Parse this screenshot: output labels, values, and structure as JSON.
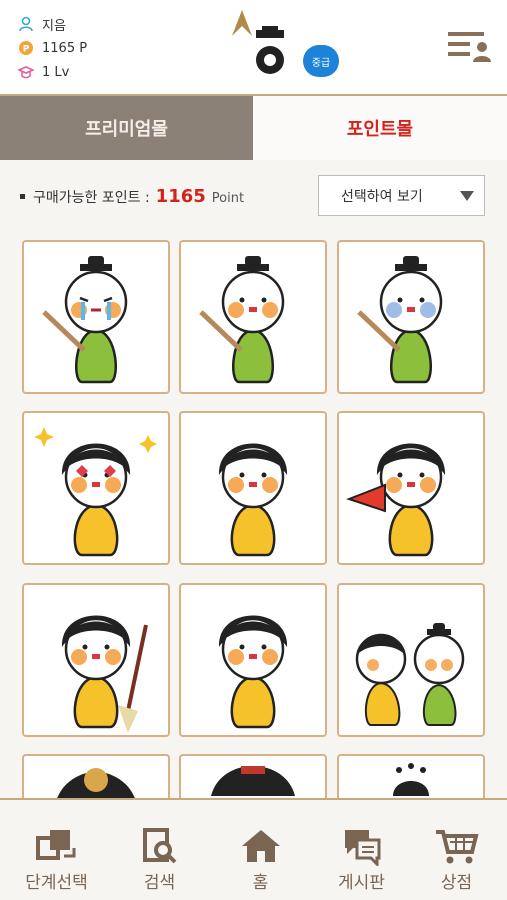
{
  "user": {
    "name": "지음",
    "points": "1165 P",
    "level": "1 Lv"
  },
  "grade_badge": "중급",
  "tabs": {
    "premium": "프리미엄몰",
    "point": "포인트몰"
  },
  "point_info": {
    "label": "구매가능한 포인트 :",
    "value": "1165",
    "unit": "Point"
  },
  "filter": {
    "selected": "선택하여 보기"
  },
  "stickers": [
    {
      "type": "boy",
      "expr": "crying",
      "prop": "brush"
    },
    {
      "type": "boy",
      "expr": "nervous",
      "prop": "brush"
    },
    {
      "type": "boy",
      "expr": "shocked",
      "prop": "brush"
    },
    {
      "type": "girl",
      "expr": "love",
      "prop": "sparkles"
    },
    {
      "type": "girl",
      "expr": "angry",
      "prop": "none"
    },
    {
      "type": "girl",
      "expr": "cheer",
      "prop": "megaphone"
    },
    {
      "type": "girl",
      "expr": "annoyed",
      "prop": "broom"
    },
    {
      "type": "girl",
      "expr": "smug",
      "prop": "none"
    },
    {
      "type": "pair",
      "expr": "happy",
      "prop": "none"
    },
    {
      "type": "partial",
      "expr": "",
      "prop": ""
    },
    {
      "type": "partial",
      "expr": "",
      "prop": ""
    },
    {
      "type": "partial",
      "expr": "",
      "prop": ""
    }
  ],
  "nav": [
    {
      "label": "단계선택",
      "icon": "stage-select-icon"
    },
    {
      "label": "검색",
      "icon": "search-book-icon"
    },
    {
      "label": "홈",
      "icon": "home-icon"
    },
    {
      "label": "게시판",
      "icon": "board-chat-icon"
    },
    {
      "label": "상점",
      "icon": "cart-icon"
    }
  ],
  "colors": {
    "accent": "#d3231b",
    "tab_inactive": "#8c8176",
    "card_border": "#d7b183",
    "nav_text": "#7a6553",
    "badge": "#1e82d8"
  }
}
